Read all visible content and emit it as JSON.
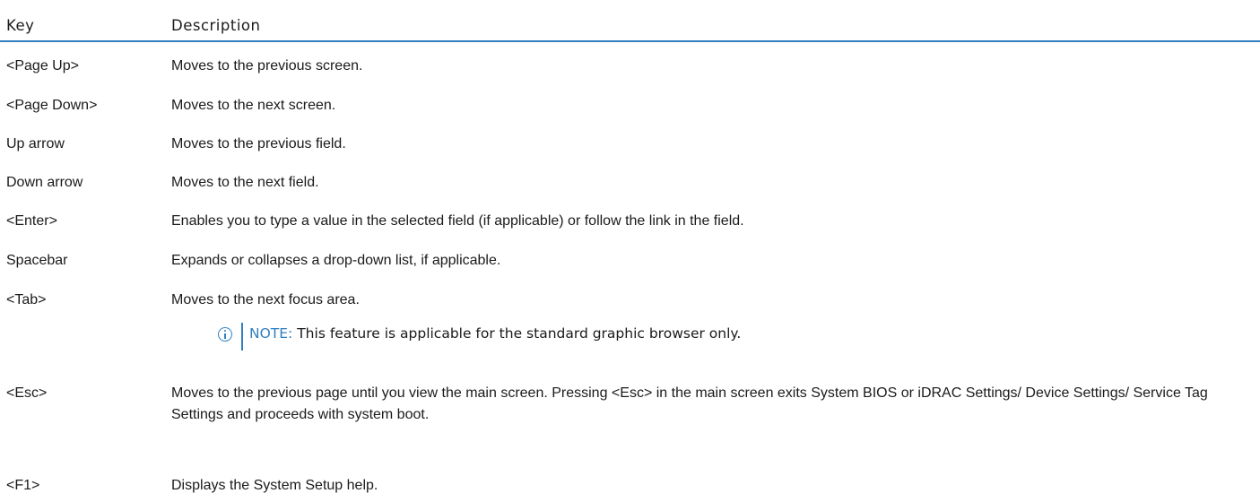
{
  "table": {
    "headers": {
      "key": "Key",
      "description": "Description"
    },
    "rows": [
      {
        "key": "<Page Up>",
        "description": "Moves to the previous screen."
      },
      {
        "key": "<Page Down>",
        "description": "Moves to the next screen."
      },
      {
        "key": "Up arrow",
        "description": "Moves to the previous field."
      },
      {
        "key": "Down arrow",
        "description": "Moves to the next field."
      },
      {
        "key": "<Enter>",
        "description": "Enables you to type a value in the selected field (if applicable) or follow the link in the field."
      },
      {
        "key": "Spacebar",
        "description": "Expands or collapses a drop-down list, if applicable."
      },
      {
        "key": "<Tab>",
        "description": "Moves to the next focus area."
      },
      {
        "key": "<Esc>",
        "description": "Moves to the previous page until you view the main screen. Pressing <Esc> in the main screen exits System BIOS or iDRAC Settings/ Device Settings/ Service Tag Settings and proceeds with system boot."
      },
      {
        "key": "<F1>",
        "description": "Displays the System Setup help."
      }
    ],
    "note": {
      "label": "NOTE:",
      "text": "This feature is applicable for the standard graphic browser only.",
      "icon": "info-icon"
    }
  },
  "colors": {
    "accent": "#2f7fc0",
    "text": "#1a1a1a"
  }
}
